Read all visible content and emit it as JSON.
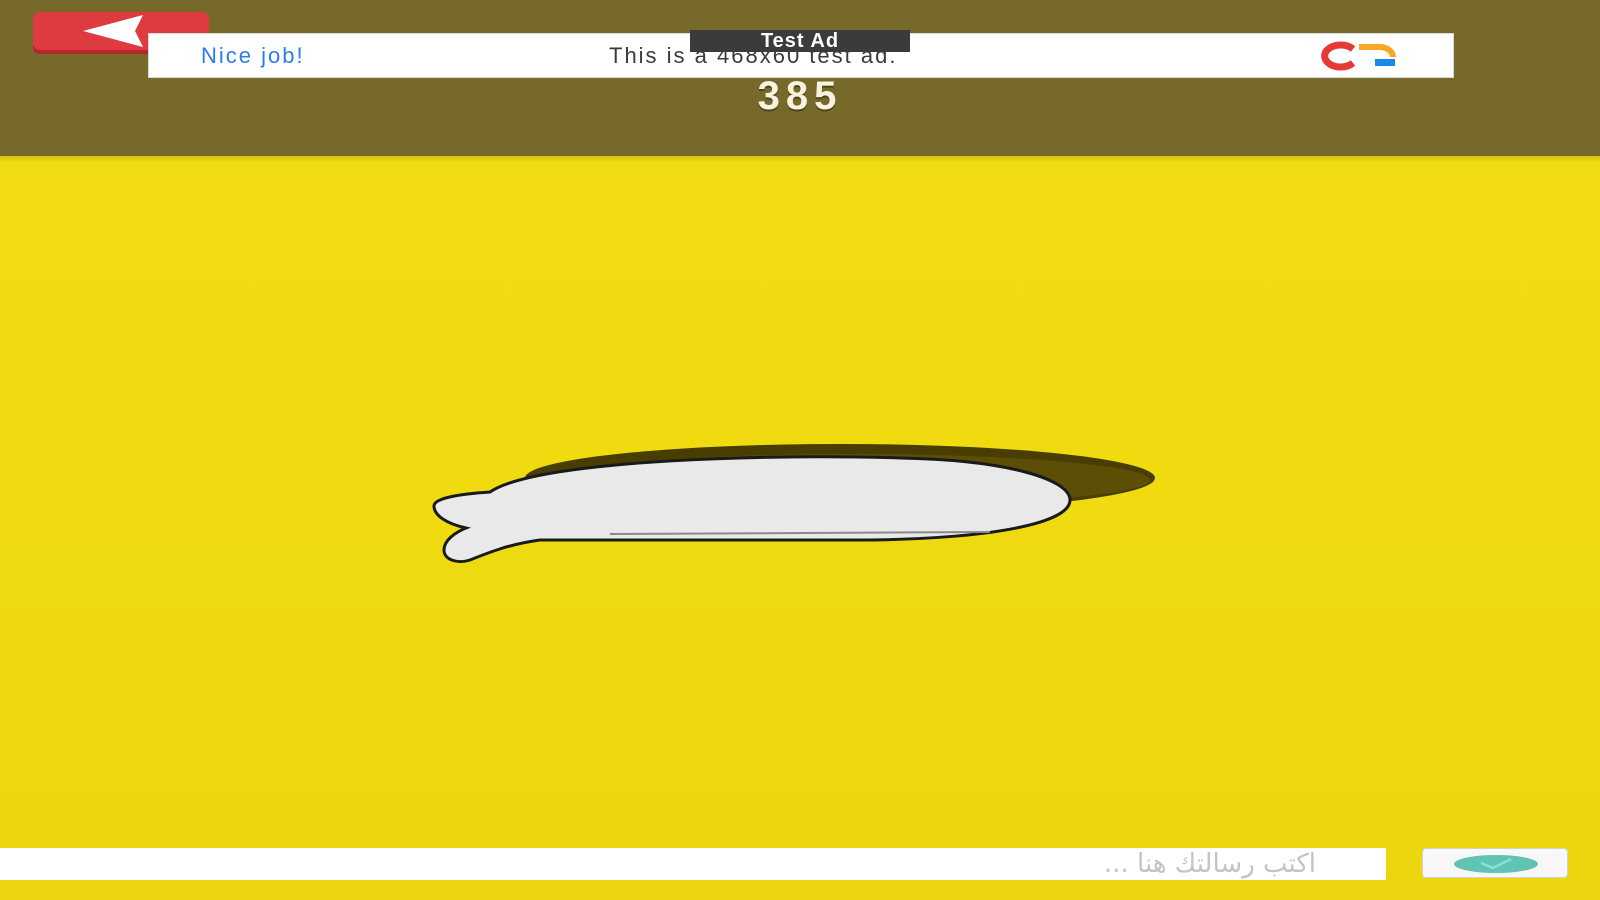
{
  "ad": {
    "label": "Test Ad",
    "headline": "Nice job!",
    "body": "This is a 468x60 test ad."
  },
  "game": {
    "score": "385"
  },
  "message": {
    "placeholder": "اكتب رسالتك هنا ...",
    "value": ""
  },
  "icons": {
    "back": "back-arrow-icon",
    "ad_logo": "ad-network-logo-icon",
    "send": "send-icon",
    "bubble": "speech-bubble-icon"
  },
  "colors": {
    "top_bar": "#77692a",
    "background": "#efdb10",
    "back_button": "#dd3b40",
    "ad_headline": "#2b7de9",
    "send_icon": "#5fc4b4"
  }
}
